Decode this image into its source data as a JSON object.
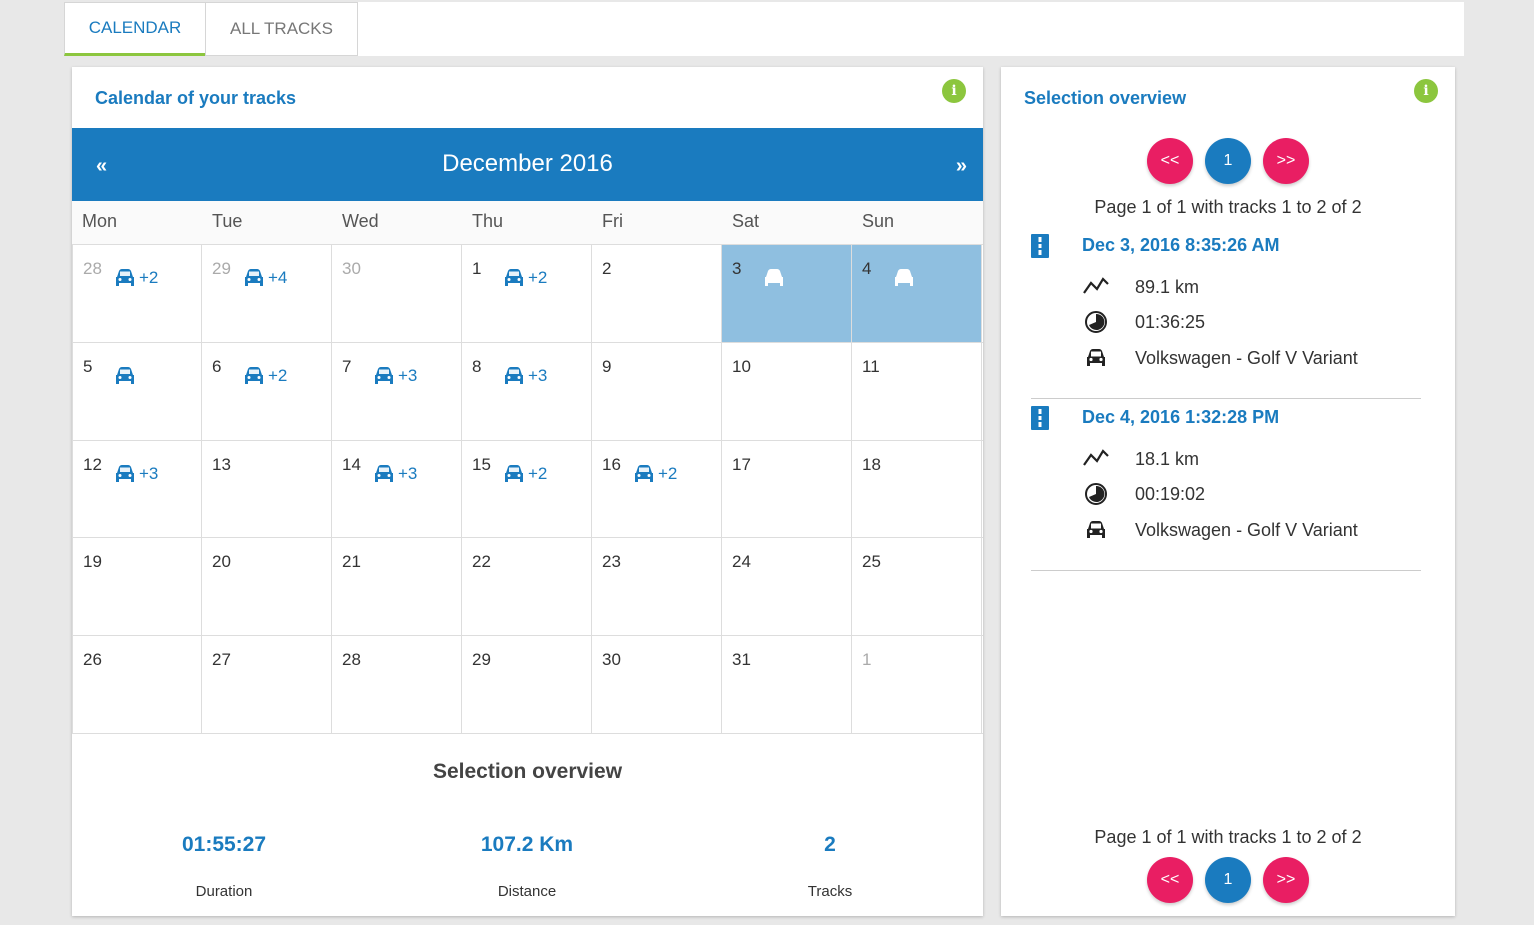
{
  "tabs": [
    {
      "label": "CALENDAR"
    },
    {
      "label": "ALL TRACKS"
    }
  ],
  "calendar_card": {
    "title": "Calendar of your tracks",
    "month_label": "December 2016",
    "prev_label": "«",
    "next_label": "»",
    "weekdays": [
      "Mon",
      "Tue",
      "Wed",
      "Thu",
      "Fri",
      "Sat",
      "Sun"
    ],
    "weeks": [
      [
        {
          "n": "28",
          "other": true,
          "car": true,
          "plus": "+2"
        },
        {
          "n": "29",
          "other": true,
          "car": true,
          "plus": "+4"
        },
        {
          "n": "30",
          "other": true
        },
        {
          "n": "1",
          "car": true,
          "plus": "+2"
        },
        {
          "n": "2"
        },
        {
          "n": "3",
          "car": true,
          "sel": true
        },
        {
          "n": "4",
          "car": true,
          "sel": true
        }
      ],
      [
        {
          "n": "5",
          "car": true
        },
        {
          "n": "6",
          "car": true,
          "plus": "+2"
        },
        {
          "n": "7",
          "car": true,
          "plus": "+3"
        },
        {
          "n": "8",
          "car": true,
          "plus": "+3"
        },
        {
          "n": "9"
        },
        {
          "n": "10"
        },
        {
          "n": "11"
        }
      ],
      [
        {
          "n": "12",
          "car": true,
          "plus": "+3"
        },
        {
          "n": "13"
        },
        {
          "n": "14",
          "car": true,
          "plus": "+3"
        },
        {
          "n": "15",
          "car": true,
          "plus": "+2"
        },
        {
          "n": "16",
          "car": true,
          "plus": "+2"
        },
        {
          "n": "17"
        },
        {
          "n": "18"
        }
      ],
      [
        {
          "n": "19"
        },
        {
          "n": "20"
        },
        {
          "n": "21"
        },
        {
          "n": "22"
        },
        {
          "n": "23"
        },
        {
          "n": "24"
        },
        {
          "n": "25"
        }
      ],
      [
        {
          "n": "26"
        },
        {
          "n": "27"
        },
        {
          "n": "28"
        },
        {
          "n": "29"
        },
        {
          "n": "30"
        },
        {
          "n": "31"
        },
        {
          "n": "1",
          "other": true
        }
      ]
    ],
    "overview_title": "Selection overview",
    "stats": [
      {
        "value": "01:55:27",
        "label": "Duration"
      },
      {
        "value": "107.2 Km",
        "label": "Distance"
      },
      {
        "value": "2",
        "label": "Tracks"
      }
    ]
  },
  "selection_card": {
    "title": "Selection overview",
    "pager": {
      "prev": "<<",
      "page": "1",
      "next": ">>"
    },
    "page_info": "Page 1 of 1 with tracks 1 to 2 of 2",
    "tracks": [
      {
        "date": "Dec 3, 2016 8:35:26 AM",
        "distance": "89.1 km",
        "duration": "01:36:25",
        "vehicle": "Volkswagen - Golf V Variant"
      },
      {
        "date": "Dec 4, 2016 1:32:28 PM",
        "distance": "18.1 km",
        "duration": "00:19:02",
        "vehicle": "Volkswagen - Golf V Variant"
      }
    ]
  },
  "colors": {
    "primary": "#1a7bbf",
    "accent": "#e91e63",
    "info": "#8cc63e",
    "selected_day": "#8fbfe0"
  }
}
